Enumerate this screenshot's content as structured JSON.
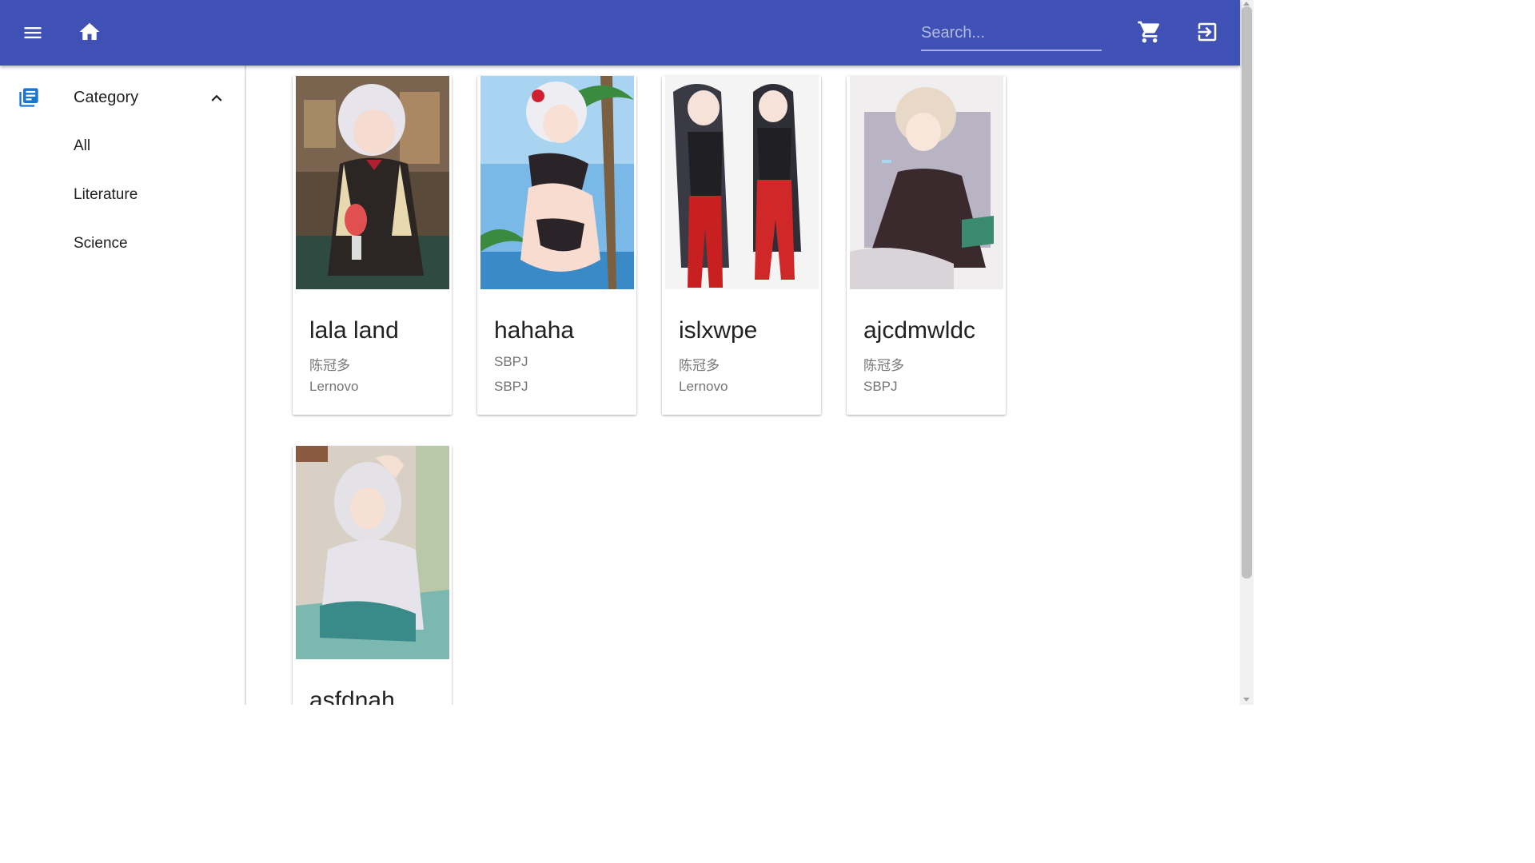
{
  "appbar": {
    "menu_icon": "menu-icon",
    "home_icon": "home-icon",
    "search": {
      "placeholder": "Search...",
      "value": ""
    },
    "cart_icon": "cart-icon",
    "logout_icon": "logout-icon",
    "color": "#3f51b5"
  },
  "sidebar": {
    "category": {
      "label": "Category",
      "icon": "library-books-icon",
      "expanded_icon": "chevron-up-icon",
      "items": [
        {
          "label": "All"
        },
        {
          "label": "Literature"
        },
        {
          "label": "Science"
        }
      ]
    },
    "accent": "#1976d2"
  },
  "books": [
    {
      "title": "lala land",
      "author": "陈冠多",
      "publisher": "Lernovo"
    },
    {
      "title": "hahaha",
      "author": "SBPJ",
      "publisher": "SBPJ"
    },
    {
      "title": "islxwpe",
      "author": "陈冠多",
      "publisher": "Lernovo"
    },
    {
      "title": "ajcdmwldc",
      "author": "陈冠多",
      "publisher": "SBPJ"
    },
    {
      "title": "asfdnah",
      "author": "",
      "publisher": ""
    }
  ]
}
